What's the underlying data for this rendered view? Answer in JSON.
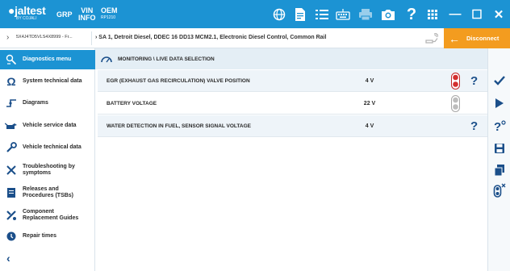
{
  "app": {
    "logo_text": "●jaltest",
    "logo_sub": "BY COJALI",
    "grp_label": "GRP",
    "vin_label_top": "VIN",
    "vin_label_bottom": "INFO",
    "oem_label": "OEM",
    "oem_sub": "RP1210"
  },
  "toolbar_icons": [
    "globe-icon",
    "document-icon",
    "list-icon",
    "keyboard-icon",
    "printer-icon",
    "camera-icon",
    "help-icon",
    "grid-icon"
  ],
  "toolbar": {
    "help_label": "?"
  },
  "window": {
    "minimize": "—",
    "maximize": "☐",
    "close": "✕"
  },
  "breadcrumb": {
    "arrow": "›",
    "vehicle_id": "5X4J4TD5VLS4X8999 - Fr...",
    "separator": "›",
    "path": "SA 1, Detroit Diesel, DDEC 16 DD13 MCM2.1, Electronic Diesel Control, Common Rail"
  },
  "disconnect": {
    "arrow": "←",
    "label": "Disconnect"
  },
  "sidebar": {
    "items": [
      {
        "label": "Diagnostics menu",
        "icon": "diagnostics-icon"
      },
      {
        "label": "System technical data",
        "icon": "ohm-icon"
      },
      {
        "label": "Diagrams",
        "icon": "diagram-icon"
      },
      {
        "label": "Vehicle service data",
        "icon": "oil-can-icon"
      },
      {
        "label": "Vehicle technical data",
        "icon": "wrench-icon"
      },
      {
        "label": "Troubleshooting by symptoms",
        "icon": "tools-icon"
      },
      {
        "label": "Releases and Procedures (TSBs)",
        "icon": "book-icon"
      },
      {
        "label": "Component Replacement Guides",
        "icon": "wrench-screwdriver-icon"
      },
      {
        "label": "Repair times",
        "icon": "clock-gear-icon"
      }
    ],
    "back": "‹"
  },
  "main": {
    "title": "MONITORING \\ LIVE DATA SELECTION",
    "rows": [
      {
        "name": "EGR (EXHAUST GAS RECIRCULATION) VALVE POSITION",
        "value": "4 V",
        "indicator": "red",
        "help": "?"
      },
      {
        "name": "BATTERY VOLTAGE",
        "value": "22 V",
        "indicator": "gray",
        "help": ""
      },
      {
        "name": "WATER DETECTION IN FUEL, SENSOR SIGNAL VOLTAGE",
        "value": "4 V",
        "indicator": "none",
        "help": "?"
      }
    ]
  },
  "rightbar": {
    "buttons": [
      "check-icon",
      "play-icon",
      "help-circle-icon",
      "save-icon",
      "multi-select-icon",
      "clear-signal-icon"
    ]
  },
  "colors": {
    "primary": "#1c93d3",
    "accent_orange": "#f39c1f",
    "icon_navy": "#1b4f8a",
    "row_alt": "#eef4f9",
    "header_bg": "#e4eef5"
  }
}
